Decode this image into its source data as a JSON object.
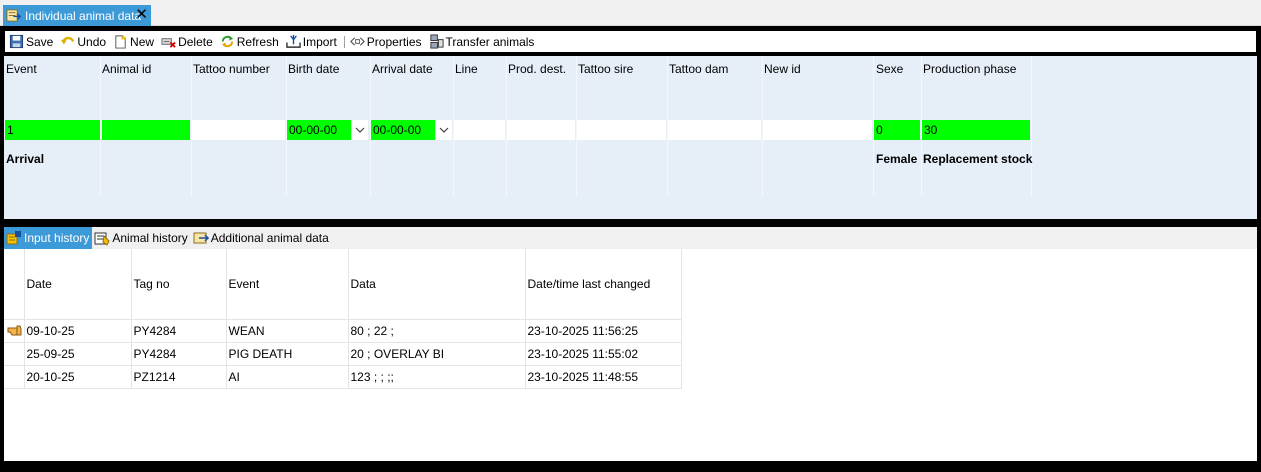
{
  "window": {
    "doc_tab_title": "Individual animal data",
    "close_glyph": "✕"
  },
  "toolbar": {
    "save": "Save",
    "undo": "Undo",
    "new": "New",
    "delete": "Delete",
    "refresh": "Refresh",
    "import": "Import",
    "properties": "Properties",
    "transfer": "Transfer animals"
  },
  "entry": {
    "headers": {
      "event": "Event",
      "animal_id": "Animal id",
      "tattoo_number": "Tattoo number",
      "birth_date": "Birth date",
      "arrival_date": "Arrival date",
      "line": "Line",
      "prod_dest": "Prod. dest.",
      "tattoo_sire": "Tattoo sire",
      "tattoo_dam": "Tattoo dam",
      "new_id": "New id",
      "sexe": "Sexe",
      "production_phase": "Production phase"
    },
    "values": {
      "event": "1",
      "animal_id": "",
      "tattoo_number": "",
      "birth_date": "00-00-00",
      "arrival_date": "00-00-00",
      "line": "",
      "prod_dest": "",
      "tattoo_sire": "",
      "tattoo_dam": "",
      "new_id": "",
      "sexe": "0",
      "production_phase": "30"
    },
    "descriptions": {
      "event": "Arrival",
      "sexe": "Female",
      "production_phase": "Replacement stock"
    },
    "required_color": "#00ff00",
    "panel_color": "#e6eef8"
  },
  "tabs": [
    {
      "label": "Input history",
      "icon": "input-history-icon",
      "active": true
    },
    {
      "label": "Animal history",
      "icon": "animal-history-icon",
      "active": false
    },
    {
      "label": "Additional animal data",
      "icon": "additional-data-icon",
      "active": false
    }
  ],
  "history": {
    "headers": {
      "date": "Date",
      "tag_no": "Tag no",
      "event": "Event",
      "data": "Data",
      "changed": "Date/time last changed"
    },
    "rows": [
      {
        "date": "09-10-25",
        "tag_no": "PY4284",
        "event": "WEAN",
        "data": "80 ; 22 ;",
        "changed": "23-10-2025 11:56:25",
        "current": true
      },
      {
        "date": "25-09-25",
        "tag_no": "PY4284",
        "event": "PIG DEATH",
        "data": "20 ; OVERLAY BI",
        "changed": "23-10-2025 11:55:02",
        "current": false
      },
      {
        "date": "20-10-25",
        "tag_no": "PZ1214",
        "event": "AI",
        "data": "123 ;  ; ;;",
        "changed": "23-10-2025 11:48:55",
        "current": false
      }
    ]
  },
  "accent_color": "#3d9ad8"
}
